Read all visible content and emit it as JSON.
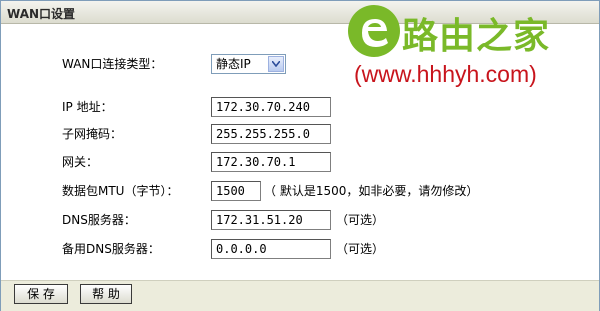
{
  "window": {
    "title": "WAN口设置"
  },
  "form": {
    "wan_type": {
      "label": "WAN口连接类型：",
      "value": "静态IP"
    },
    "ip": {
      "label": "IP 地址：",
      "value": "172.30.70.240"
    },
    "mask": {
      "label": "子网掩码：",
      "value": "255.255.255.0"
    },
    "gateway": {
      "label": "网关：",
      "value": "172.30.70.1"
    },
    "mtu": {
      "label": "数据包MTU（字节）：",
      "value": "1500",
      "note": "（ 默认是1500，如非必要，请勿修改）"
    },
    "dns": {
      "label": "DNS服务器：",
      "value": "172.31.51.20",
      "note": "（可选）"
    },
    "dns_alt": {
      "label": "备用DNS服务器：",
      "value": "0.0.0.0",
      "note": "（可选）"
    }
  },
  "buttons": {
    "save": "保 存",
    "help": "帮 助"
  },
  "watermark": {
    "logo_text": "路由之家",
    "url": "(www.hhhyh.com)",
    "brand_color": "#7ab929",
    "url_color": "#c8141c"
  },
  "icons": {
    "dropdown": "chevron-down-icon",
    "logo": "e-logo-icon"
  }
}
